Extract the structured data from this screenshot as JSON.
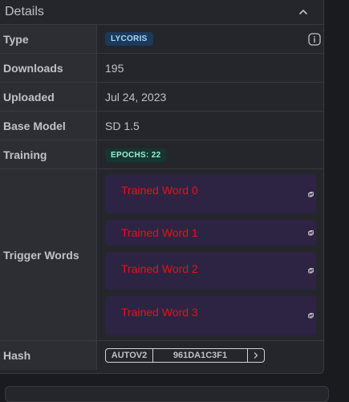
{
  "header": {
    "title": "Details"
  },
  "rows": {
    "type": {
      "label": "Type",
      "badge": "LYCORIS"
    },
    "downloads": {
      "label": "Downloads",
      "value": "195"
    },
    "uploaded": {
      "label": "Uploaded",
      "value": "Jul 24, 2023"
    },
    "base_model": {
      "label": "Base Model",
      "value": "SD 1.5"
    },
    "training": {
      "label": "Training",
      "badge": "EPOCHS: 22"
    },
    "trigger_words": {
      "label": "Trigger Words",
      "words": [
        "Trained Word 0",
        "Trained Word 1",
        "Trained Word 2",
        "Trained Word 3"
      ]
    },
    "hash": {
      "label": "Hash",
      "algorithm": "AUTOV2",
      "value": "961DA1C3F1"
    }
  },
  "colors": {
    "trigger_word_text": "#e8101a",
    "trigger_word_bg": "#2d2443",
    "type_badge_bg": "#1c3a5a",
    "epoch_badge_bg": "#16362f"
  },
  "icons": {
    "collapse": "chevron-up-icon",
    "info": "info-icon",
    "copy": "copy-icon",
    "hash_next": "chevron-right-icon"
  }
}
